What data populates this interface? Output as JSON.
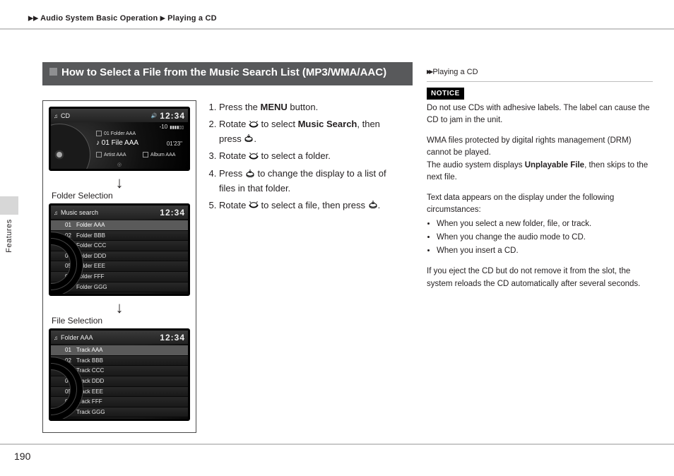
{
  "breadcrumb": {
    "a": "Audio System Basic Operation",
    "b": "Playing a CD"
  },
  "side_tab": "Features",
  "page_number": "190",
  "title": "How to Select a File from the Music Search List (MP3/WMA/AAC)",
  "steps": {
    "s1_a": "Press the ",
    "s1_b": "MENU",
    "s1_c": " button.",
    "s2_a": "Rotate ",
    "s2_b": " to select ",
    "s2_c": "Music Search",
    "s2_d": ", then press ",
    "s3_a": "Rotate ",
    "s3_b": " to select a folder.",
    "s4_a": "Press ",
    "s4_b": " to change the display to a list of files in that folder.",
    "s5_a": "Rotate ",
    "s5_b": " to select a file, then press "
  },
  "labels": {
    "folder_sel": "Folder Selection",
    "file_sel": "File Selection"
  },
  "screens": {
    "clock": "12:34",
    "cd": {
      "title": "CD",
      "db": "-10",
      "track": "01  Folder AAA",
      "file": "01 File AAA",
      "dur": "01'23\"",
      "artist": "Artist AAA",
      "album": "Album AAA"
    },
    "folders": {
      "title": "Music search",
      "items": [
        {
          "n": "01",
          "t": "Folder AAA"
        },
        {
          "n": "02",
          "t": "Folder BBB"
        },
        {
          "n": "03",
          "t": "Folder CCC"
        },
        {
          "n": "04",
          "t": "Folder DDD"
        },
        {
          "n": "05",
          "t": "Folder EEE"
        },
        {
          "n": "06",
          "t": "Folder FFF"
        },
        {
          "n": "07",
          "t": "Folder GGG"
        }
      ]
    },
    "files": {
      "title": "Folder AAA",
      "items": [
        {
          "n": "01",
          "t": "Track AAA"
        },
        {
          "n": "02",
          "t": "Track BBB"
        },
        {
          "n": "03",
          "t": "Track CCC"
        },
        {
          "n": "04",
          "t": "Track DDD"
        },
        {
          "n": "05",
          "t": "Track EEE"
        },
        {
          "n": "06",
          "t": "Track FFF"
        },
        {
          "n": "07",
          "t": "Track GGG"
        }
      ]
    }
  },
  "notes": {
    "heading": "Playing a CD",
    "notice": "NOTICE",
    "p1": "Do not use CDs with adhesive labels. The label can cause the CD to jam in the unit.",
    "p2a": "WMA files protected by digital rights management (DRM) cannot be played.",
    "p2b_a": "The audio system displays ",
    "p2b_b": "Unplayable File",
    "p2b_c": ", then skips to the next file.",
    "p3": "Text data appears on the display under the following circumstances:",
    "b1": "When you select a new folder, file, or track.",
    "b2": "When you change the audio mode to CD.",
    "b3": "When you insert a CD.",
    "p4": "If you eject the CD but do not remove it from the slot, the system reloads the CD automatically after several seconds."
  }
}
